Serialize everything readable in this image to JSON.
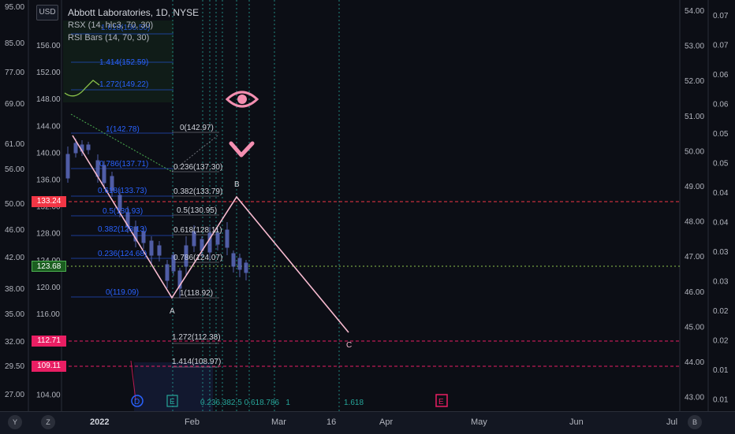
{
  "legend": {
    "title": "Abbott Laboratories, 1D, NYSE",
    "indicator1": "RSX (14, hlc3, 70, 30)",
    "indicator2": "RSI Bars (14, 70, 30)"
  },
  "currency_button": "USD",
  "left_axis_labels": [
    "95.00",
    "85.00",
    "77.00",
    "69.00",
    "61.00",
    "56.00",
    "50.00",
    "46.00",
    "42.00",
    "38.00",
    "35.00",
    "32.00",
    "29.50",
    "27.00"
  ],
  "price_axis_labels": [
    "156.00",
    "152.00",
    "148.00",
    "144.00",
    "140.00",
    "136.00",
    "132.00",
    "128.00",
    "124.00",
    "120.00",
    "116.00",
    "112.00",
    "108.00",
    "104.00"
  ],
  "right_axis1_labels": [
    "54.00",
    "53.00",
    "52.00",
    "51.00",
    "50.00",
    "49.00",
    "48.00",
    "47.00",
    "46.00",
    "45.00",
    "44.00",
    "43.00"
  ],
  "right_axis2_labels": [
    "0.07",
    "0.07",
    "0.06",
    "0.06",
    "0.05",
    "0.05",
    "0.04",
    "0.04",
    "0.03",
    "0.03",
    "0.02",
    "0.02",
    "0.01",
    "0.01"
  ],
  "price_badges": [
    {
      "value": "133.24",
      "color": "#f23645"
    },
    {
      "value": "123.68",
      "color": "#26a69a"
    },
    {
      "value": "112.71",
      "color": "#e91e63"
    },
    {
      "value": "109.11",
      "color": "#e91e63"
    }
  ],
  "fib_left": [
    "1.414(152.59)",
    "1.272(149.22)",
    "1(142.78)",
    "0.786(137.71)",
    "0.618(133.73)",
    "0.5(130.93)",
    "0.382(128.13)",
    "0.236(124.68)",
    "0(119.09)"
  ],
  "fib_right": [
    "0(142.97)",
    "0.236(137.30)",
    "0.382(133.79)",
    "0.5(130.95)",
    "0.618(128.11)",
    "0.786(124.07)",
    "1(118.92)",
    "1.272(112.38)",
    "1.414(108.97)"
  ],
  "fib_top_partial": "1.618(156.50)",
  "wave_labels": {
    "a": "A",
    "b": "B",
    "c": "C"
  },
  "time_fib_labels": "0.236.382.5 0.618.786   1",
  "time_fib_1618": "1.618",
  "markers": {
    "d": "D",
    "e1": "E",
    "e2": "E"
  },
  "time_axis": [
    "2022",
    "Feb",
    "Mar",
    "16",
    "Apr",
    "May",
    "Jun",
    "Jul"
  ],
  "corner_buttons": {
    "y": "Y",
    "z": "Z",
    "b": "B"
  },
  "colors": {
    "bg": "#0c0e15",
    "fib_blue": "#2962ff",
    "fib_white": "#d1d4dc",
    "wave": "#f8bbd0",
    "accent_pink": "#f48fb1"
  }
}
